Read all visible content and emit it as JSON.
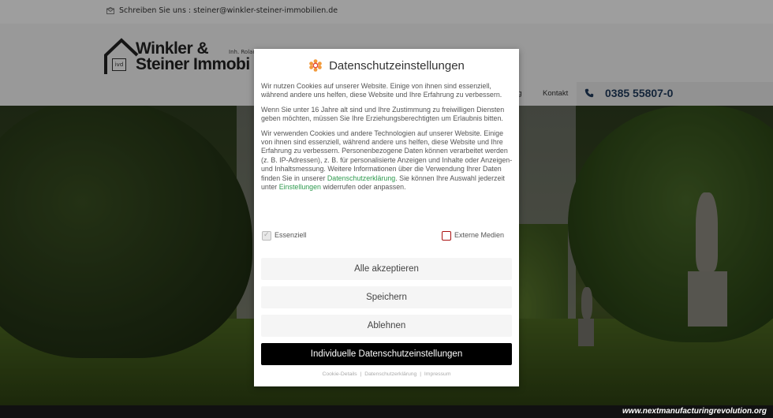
{
  "topbar": {
    "mail_icon": "envelope-icon",
    "mail_text": "Schreiben Sie uns : steiner@winkler-steiner-immobilien.de"
  },
  "logo": {
    "line1": "Winkler &",
    "line2": "Steiner Immobi",
    "owner": "Inh. Rolan",
    "badge": "ivd"
  },
  "nav": {
    "partial_item": "ng",
    "kontakt": "Kontakt"
  },
  "phone": {
    "icon": "phone-icon",
    "number": "0385 55807-0"
  },
  "consent": {
    "icon": "cookie-flower-icon",
    "title": "Datenschutzeinstellungen",
    "para1": "Wir nutzen Cookies auf unserer Website. Einige von ihnen sind essenziell, während andere uns helfen, diese Website und Ihre Erfahrung zu verbessern.",
    "para2": "Wenn Sie unter 16 Jahre alt sind und Ihre Zustimmung zu freiwilligen Diensten geben möchten, müssen Sie Ihre Erziehungsberechtigten um Erlaubnis bitten.",
    "para3_a": "Wir verwenden Cookies und andere Technologien auf unserer Website. Einige von ihnen sind essenziell, während andere uns helfen, diese Website und Ihre Erfahrung zu verbessern. Personenbezogene Daten können verarbeitet werden (z. B. IP-Adressen), z. B. für personalisierte Anzeigen und Inhalte oder Anzeigen- und Inhaltsmessung. Weitere Informationen über die Verwendung Ihrer Daten finden Sie in unserer ",
    "para3_link1": "Datenschutzerklärung",
    "para3_b": ". Sie können Ihre Auswahl jederzeit unter ",
    "para3_link2": "Einstellungen",
    "para3_c": " widerrufen oder anpassen.",
    "check_essential": "Essenziell",
    "check_external": "Externe Medien",
    "btn_accept": "Alle akzeptieren",
    "btn_save": "Speichern",
    "btn_reject": "Ablehnen",
    "btn_individual": "Individuelle Datenschutzeinstellungen",
    "link_cookie": "Cookie-Details",
    "link_privacy": "Datenschutzerklärung",
    "link_imprint": "Impressum",
    "separator": "|"
  },
  "watermark": "www.nextmanufacturingrevolution.org",
  "colors": {
    "link_green": "#2e9a4e",
    "phone_blue": "#1f3a5c",
    "checkbox_red": "#a11111"
  }
}
